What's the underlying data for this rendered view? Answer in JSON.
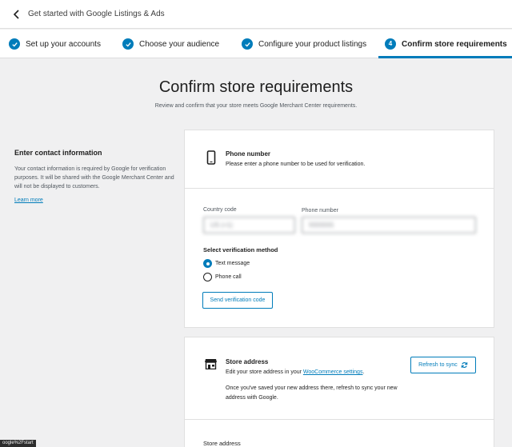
{
  "header": {
    "title": "Get started with Google Listings & Ads",
    "back_icon": "chevron-left-icon"
  },
  "stepper": {
    "steps": [
      {
        "label": "Set up your accounts",
        "state": "complete"
      },
      {
        "label": "Choose your audience",
        "state": "complete"
      },
      {
        "label": "Configure your product listings",
        "state": "complete"
      },
      {
        "label": "Confirm store requirements",
        "state": "active",
        "number": "4"
      }
    ],
    "accent_color": "#007cba"
  },
  "page": {
    "title": "Confirm store requirements",
    "subtitle": "Review and confirm that your store meets Google Merchant Center requirements."
  },
  "contact": {
    "title": "Enter contact information",
    "description": "Your contact information is required by Google for verification purposes. It will be shared with the Google Merchant Center and will not be displayed to customers.",
    "learn_more": "Learn more"
  },
  "phone_card": {
    "icon": "smartphone-icon",
    "title": "Phone number",
    "description": "Please enter a phone number to be used for verification.",
    "country_code_label": "Country code",
    "country_code_value": "US (+1)",
    "phone_number_label": "Phone number",
    "phone_number_value": "5555555",
    "verification_title": "Select verification method",
    "methods": [
      {
        "label": "Text message",
        "checked": true
      },
      {
        "label": "Phone call",
        "checked": false
      }
    ],
    "send_button": "Send verification code"
  },
  "store_card": {
    "icon": "store-icon",
    "title": "Store address",
    "description_prefix": "Edit your store address in your ",
    "description_link": "WooCommerce settings",
    "description_suffix": ".",
    "note": "Once you've saved your new address there, refresh to sync your new address with Google.",
    "refresh_button": "Refresh to sync",
    "section_label": "Store address"
  },
  "status_bar": {
    "text": "oogle%2Fstart"
  }
}
